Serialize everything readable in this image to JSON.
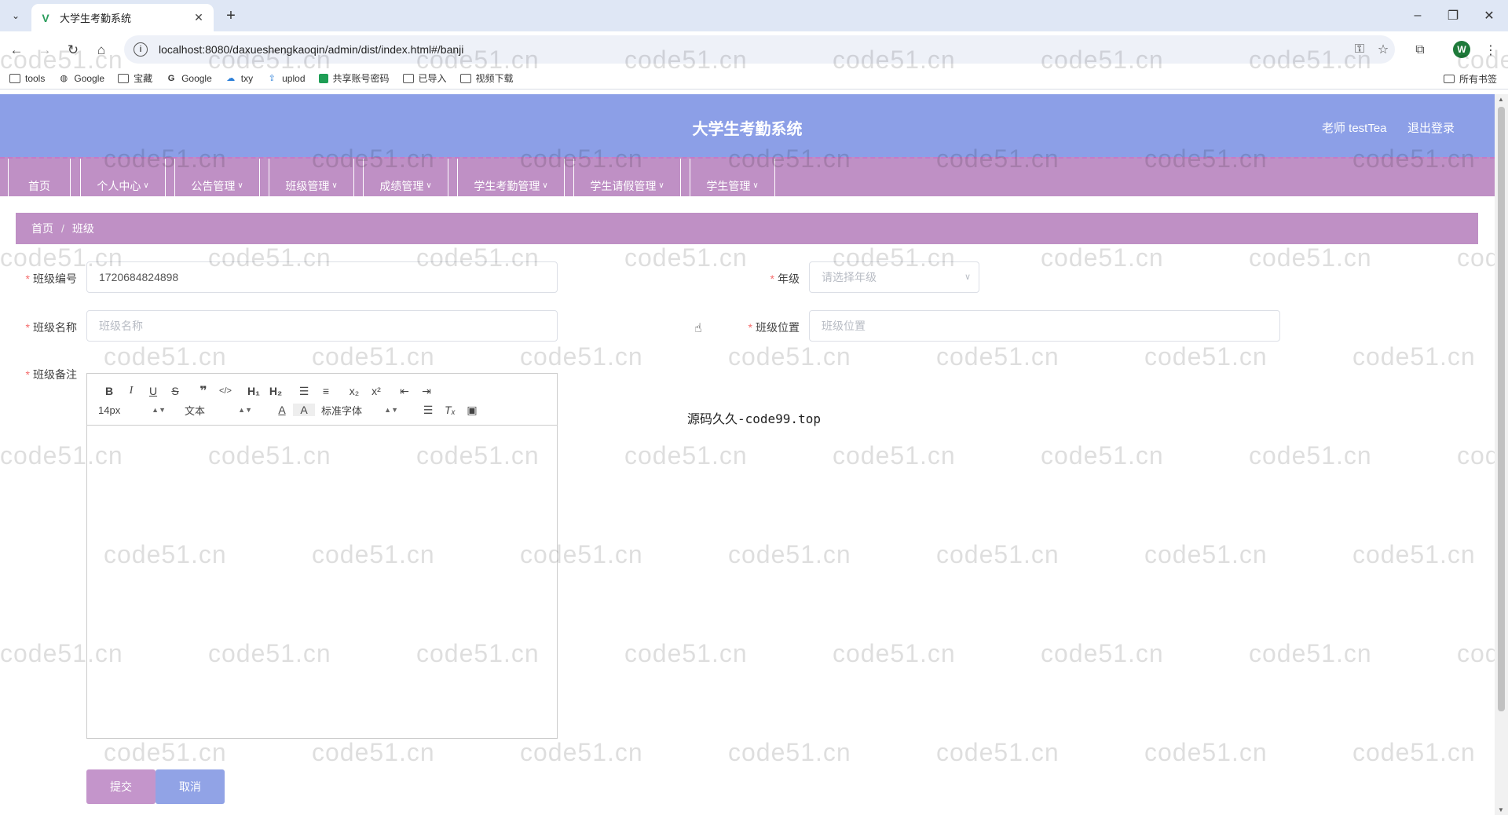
{
  "browser": {
    "tab_title": "大学生考勤系统",
    "tab_favicon": "V",
    "tab_close": "✕",
    "new_tab": "+",
    "url": "localhost:8080/daxueshengkaoqin/admin/dist/index.html#/banji",
    "profile_initial": "W",
    "bookmarks": [
      {
        "label": "tools",
        "icon": "folder-icon"
      },
      {
        "label": "Google",
        "icon": "google-icon"
      },
      {
        "label": "宝藏",
        "icon": "folder-icon"
      },
      {
        "label": "Google",
        "icon": "google-g-icon"
      },
      {
        "label": "txy",
        "icon": "cloud-icon"
      },
      {
        "label": "uplod",
        "icon": "upload-icon"
      },
      {
        "label": "共享账号密码",
        "icon": "sheet-icon"
      },
      {
        "label": "已导入",
        "icon": "folder-icon"
      },
      {
        "label": "视频下载",
        "icon": "folder-icon"
      }
    ],
    "all_bookmarks": "所有书签"
  },
  "header": {
    "title": "大学生考勤系统",
    "user": "老师 testTea",
    "logout": "退出登录"
  },
  "menu": [
    {
      "label": "首页",
      "dropdown": false
    },
    {
      "label": "个人中心",
      "dropdown": true
    },
    {
      "label": "公告管理",
      "dropdown": true
    },
    {
      "label": "班级管理",
      "dropdown": true
    },
    {
      "label": "成绩管理",
      "dropdown": true
    },
    {
      "label": "学生考勤管理",
      "dropdown": true
    },
    {
      "label": "学生请假管理",
      "dropdown": true
    },
    {
      "label": "学生管理",
      "dropdown": true
    }
  ],
  "breadcrumb": {
    "home": "首页",
    "separator": "/",
    "current": "班级"
  },
  "form": {
    "class_no": {
      "label": "班级编号",
      "value": "1720684824898"
    },
    "grade": {
      "label": "年级",
      "placeholder": "请选择年级"
    },
    "class_name": {
      "label": "班级名称",
      "placeholder": "班级名称"
    },
    "class_location": {
      "label": "班级位置",
      "placeholder": "班级位置"
    },
    "class_remark": {
      "label": "班级备注"
    }
  },
  "editor": {
    "font_size": "14px",
    "text_type": "文本",
    "font_family": "标准字体"
  },
  "buttons": {
    "submit": "提交",
    "cancel": "取消"
  },
  "overlay_text": "源码久久-code99.top",
  "watermark_text": "code51.cn",
  "watermark_partial_left": "cn",
  "watermark_partial_right": "cod",
  "colors": {
    "header": "#8c9fe7",
    "menubar": "#bf90c5",
    "submit": "#c495cb",
    "cancel": "#91a3e6"
  }
}
